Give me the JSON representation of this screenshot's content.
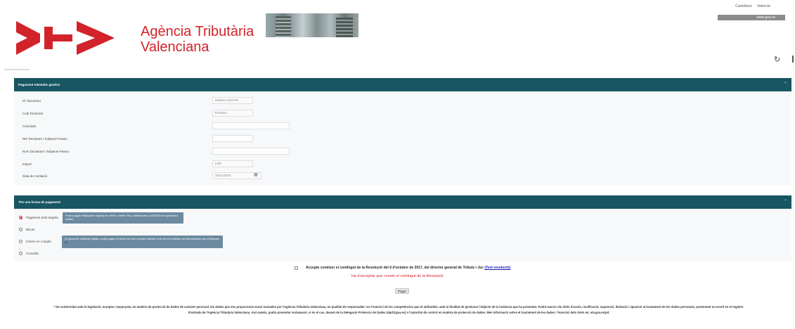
{
  "top_links": {
    "lang1": "Castellano",
    "lang2": "Valencià",
    "gva": "www.gva.es"
  },
  "brand": {
    "line1": "Agència Tributària",
    "line2": "Valenciana"
  },
  "colors": {
    "brand_red": "#d2232a",
    "panel_header": "#185663",
    "tooltip": "#6c8aa0"
  },
  "panel1": {
    "title": "Pagament telemàtic genèric",
    "fields": [
      {
        "label": "Nº document",
        "value": "0462617163746"
      },
      {
        "label": "Codi Territorial",
        "value": "PG4023"
      },
      {
        "label": "Concepte",
        "value": ""
      },
      {
        "label": "NIF Declarant / Subjecte Passiu",
        "value": ""
      },
      {
        "label": "Nom Declarant / Subjecte Passiu",
        "value": ""
      },
      {
        "label": "Import",
        "value": "0,00"
      },
      {
        "label": "Data de meritació",
        "value": "15/12/2024"
      }
    ]
  },
  "panel2": {
    "title": "Trie una forma de pagament",
    "options": [
      {
        "label": "Pagament amb targeta",
        "selected": true
      },
      {
        "label": "Bizum",
        "selected": false
      },
      {
        "label": "Càrrec en compte",
        "selected": false
      },
      {
        "label": "Consulta",
        "selected": false
      }
    ],
    "tip_card": "Podrà pagar mitjançant targeta de crèdit o dèbit: Visa, Mastercard o 4B/6000 de qualsevol entitat.",
    "tip_account": "Si posseeix certificat digital, podrà pagar a través del seu compte bancari si és de les entitats col·laboradores que s'indiquen",
    "tip_account_link": "ací"
  },
  "accept": {
    "text": "Accepte conèixer el contingut de la Resolució del 6 d'octubre de 2017, del director general de Tributs i Joc",
    "link": "(Text resolució)",
    "error": "Ha d'acceptar que coneix el contingut de la Resolució"
  },
  "pay_button": "Pagar",
  "footer": {
    "line1": "* De conformitat amb la legislació, europea i espanyola, en matèria de protecció de dades de caràcter personal, les dades que ens proporcione seran tractades per l'Agència Tributària Valenciana, en qualitat de responsable i en l'exercici de les competències que té atribuïdes, amb la finalitat de gestionar l'objecte de la instància que ha presentat. Podrà exercir els drets d'accés, rectificació, supressió, limitació i oposició al tractament de les dades personals, presentant un escrit en el registre",
    "line2": "d'entrada de l'Agència Tributària Valenciana. Així mateix, podrà presentar reclamació, si és el cas, davant de la Delegació Protecció de Dades (dpd@gva.es) o l'autoritat de control en matèria de protecció de dades. Més informació sobre el tractament de les dades i l'exercici dels drets en: atv.gva.es/pd"
  }
}
